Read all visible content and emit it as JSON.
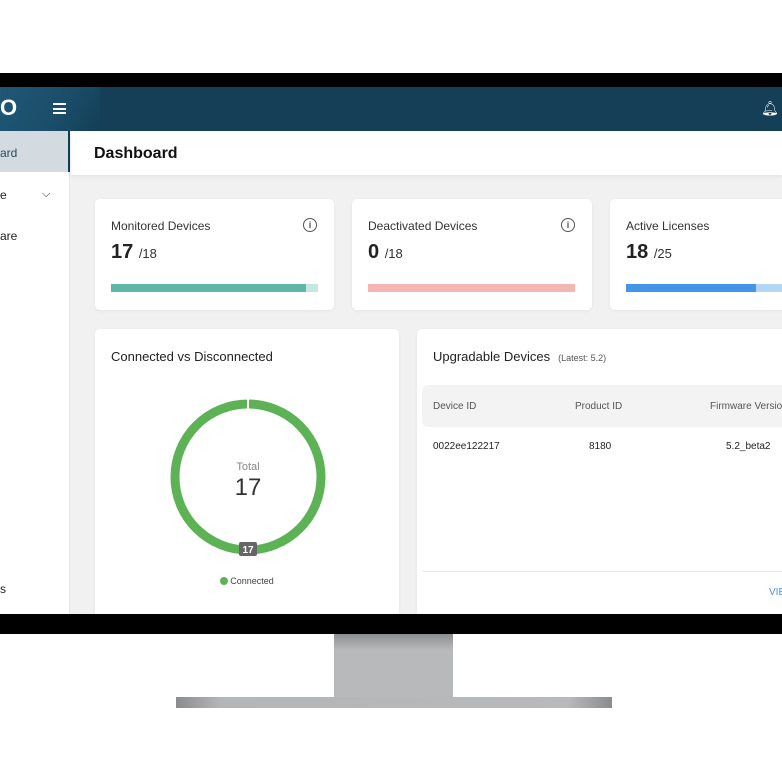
{
  "header": {
    "logo": "O",
    "bell_icon": "bell-icon",
    "menu_icon": "hamburger-icon",
    "color": "#143f57"
  },
  "sidebar": {
    "items": [
      {
        "label": "ard",
        "active": true
      },
      {
        "label": "e"
      },
      {
        "label": "are"
      },
      {
        "label": "s"
      }
    ]
  },
  "page_title": "Dashboard",
  "stats": [
    {
      "label": "Monitored Devices",
      "value": "17",
      "total": "/18",
      "fraction": 0.944,
      "color": "#5fb7a9",
      "track": "#c4e6e0",
      "info": true
    },
    {
      "label": "Deactivated Devices",
      "value": "0",
      "total": "/18",
      "fraction": 0,
      "color": "#f3b7b1",
      "track": "#f3b7b1",
      "info": true
    },
    {
      "label": "Active Licenses",
      "value": "18",
      "total": "/25",
      "fraction": 0.72,
      "color": "#4495e8",
      "track": "#b3d5f6",
      "info": false
    }
  ],
  "connection_chart": {
    "title": "Connected vs Disconnected",
    "center_label": "Total",
    "center_value": "17",
    "segments": [
      {
        "name": "Connected",
        "value": 17,
        "color": "#5cb254"
      }
    ]
  },
  "upgradable": {
    "title": "Upgradable Devices",
    "latest": "(Latest: 5.2)",
    "columns": [
      "Device ID",
      "Product ID",
      "Firmware Versio"
    ],
    "rows": [
      [
        "0022ee122217",
        "8180",
        "5.2_beta2"
      ]
    ],
    "view_link": "VIE"
  }
}
